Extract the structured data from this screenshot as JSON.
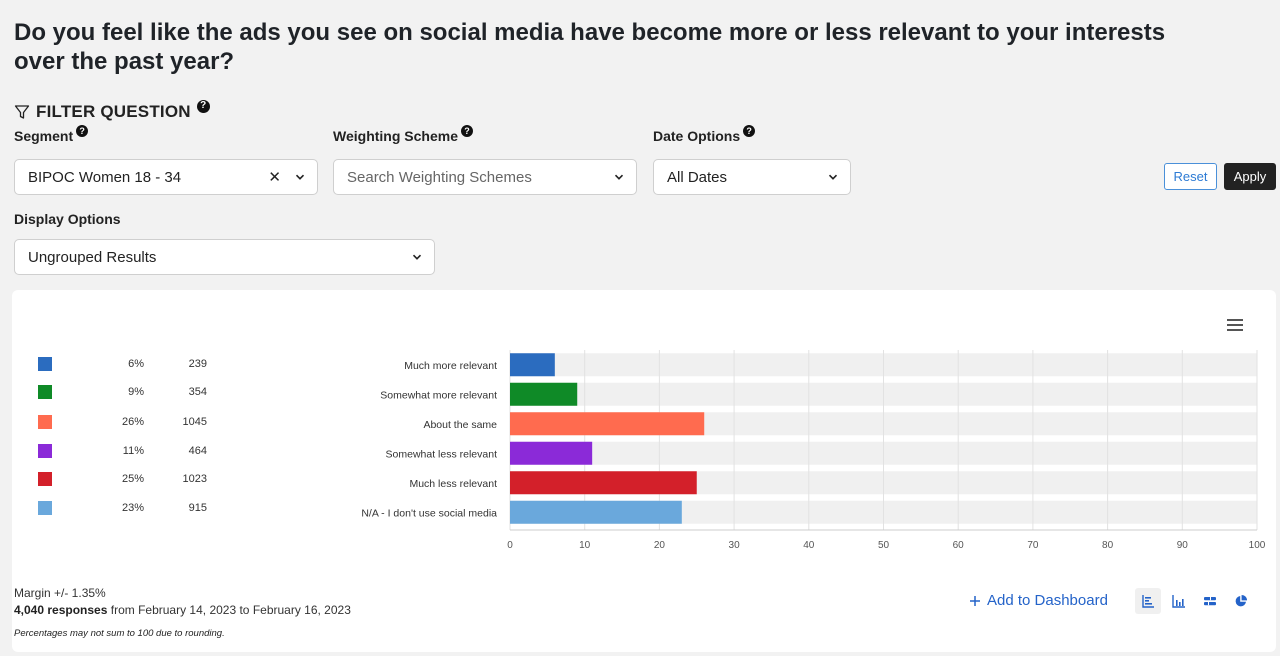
{
  "page": {
    "title": "Do you feel like the ads you see on social media have become more or less relevant to your interests over the past year?"
  },
  "filter": {
    "heading": "FILTER QUESTION",
    "segment_label": "Segment",
    "segment_value": "BIPOC Women 18 - 34",
    "weighting_label": "Weighting Scheme",
    "weighting_placeholder": "Search Weighting Schemes",
    "date_label": "Date Options",
    "date_value": "All Dates",
    "reset_label": "Reset",
    "apply_label": "Apply",
    "display_label": "Display Options",
    "display_value": "Ungrouped Results",
    "help_glyph": "?"
  },
  "legend": [
    {
      "color": "#2b6cbf",
      "pct": "6%",
      "count": "239"
    },
    {
      "color": "#0f8a27",
      "pct": "9%",
      "count": "354"
    },
    {
      "color": "#ff6b4f",
      "pct": "26%",
      "count": "1045"
    },
    {
      "color": "#8b2ad8",
      "pct": "11%",
      "count": "464"
    },
    {
      "color": "#d3202a",
      "pct": "25%",
      "count": "1023"
    },
    {
      "color": "#6aa8dc",
      "pct": "23%",
      "count": "915"
    }
  ],
  "chart_data": {
    "type": "bar",
    "orientation": "horizontal",
    "categories": [
      "Much more relevant",
      "Somewhat more relevant",
      "About the same",
      "Somewhat less relevant",
      "Much less relevant",
      "N/A - I don't use social media"
    ],
    "values": [
      6,
      9,
      26,
      11,
      25,
      23
    ],
    "colors": [
      "#2b6cbf",
      "#0f8a27",
      "#ff6b4f",
      "#8b2ad8",
      "#d3202a",
      "#6aa8dc"
    ],
    "xlim": [
      0,
      100
    ],
    "xticks": [
      0,
      10,
      20,
      30,
      40,
      50,
      60,
      70,
      80,
      90,
      100
    ],
    "grid": true,
    "title": "",
    "xlabel": "",
    "ylabel": ""
  },
  "footer": {
    "margin": "Margin +/- 1.35%",
    "responses_bold": "4,040 responses",
    "responses_rest": " from February 14, 2023 to February 16, 2023",
    "note": "Percentages may not sum to 100 due to rounding.",
    "add_dashboard": "Add to Dashboard"
  },
  "icons": {
    "filter": "filter-icon",
    "menu": "hamburger-menu-icon",
    "views": [
      "horizontal-bar-view-icon",
      "column-bar-view-icon",
      "stacked-bar-view-icon",
      "pie-view-icon"
    ]
  }
}
